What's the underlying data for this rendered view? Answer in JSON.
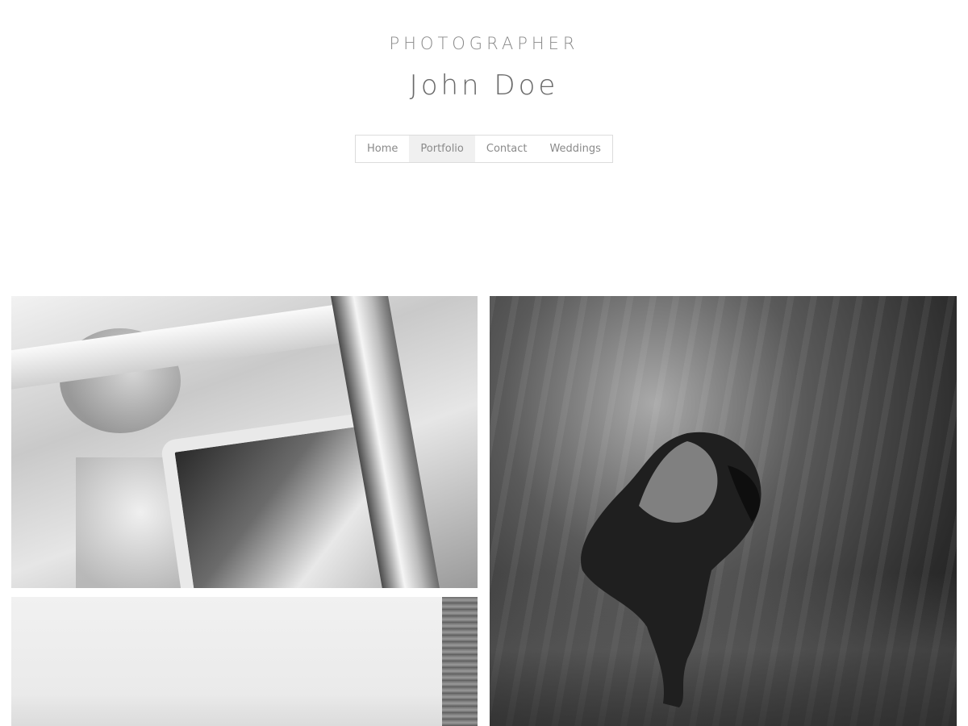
{
  "header": {
    "role": "PHOTOGRAPHER",
    "name": "John Doe"
  },
  "nav": {
    "items": [
      {
        "label": "Home",
        "active": false
      },
      {
        "label": "Portfolio",
        "active": true
      },
      {
        "label": "Contact",
        "active": false
      },
      {
        "label": "Weddings",
        "active": false
      }
    ]
  },
  "gallery": {
    "photos": [
      {
        "name": "wedding-car-photo"
      },
      {
        "name": "underwater-photo"
      },
      {
        "name": "misty-landscape-photo"
      }
    ]
  },
  "colors": {
    "text": "#8a8a8a",
    "nav_border": "#dcdcdc",
    "nav_active_bg": "#f0f0f0"
  }
}
